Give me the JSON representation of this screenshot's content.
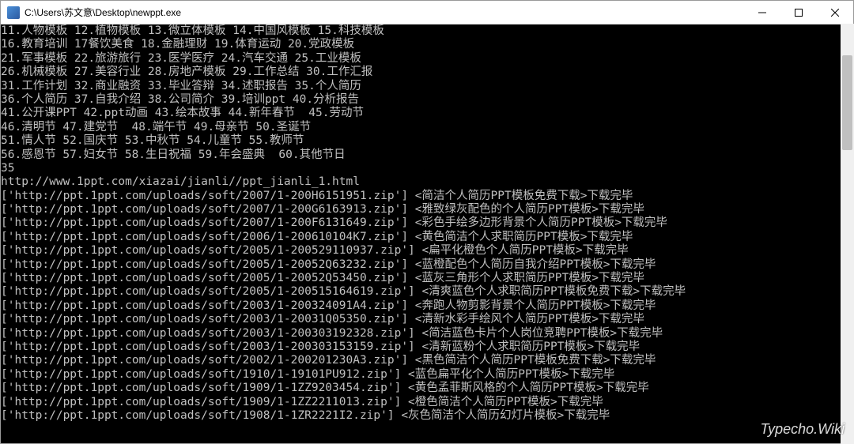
{
  "window": {
    "title": "C:\\Users\\苏文意\\Desktop\\newppt.exe"
  },
  "watermark": "Typecho.Wiki",
  "categories": [
    "11.人物模板 12.植物模板 13.微立体模板 14.中国风模板 15.科技模板",
    "16.教育培训 17餐饮美食 18.金融理财 19.体育运动 20.党政模板",
    "21.军事模板 22.旅游旅行 23.医学医疗 24.汽车交通 25.工业模板",
    "26.机械模板 27.美容行业 28.房地产模板 29.工作总结 30.工作汇报",
    "31.工作计划 32.商业融资 33.毕业答辩 34.述职报告 35.个人简历",
    "36.个人简历 37.自我介绍 38.公司简介 39.培训ppt 40.分析报告",
    "41.公开课PPT 42.ppt动画 43.绘本故事 44.新年春节  45.劳动节",
    "46.清明节 47.建党节  48.端午节 49.母亲节 50.圣诞节",
    "51.情人节 52.国庆节 53.中秋节 54.儿童节 55.教师节",
    "56.感恩节 57.妇女节 58.生日祝福 59.年会盛典  60.其他节日"
  ],
  "selection": "35",
  "url": "http://www.1ppt.com/xiazai/jianli//ppt_jianli_1.html",
  "downloads": [
    {
      "file": "['http://ppt.1ppt.com/uploads/soft/2007/1-200H6151951.zip'] ",
      "desc": "<简洁个人简历PPT模板免费下载>下载完毕"
    },
    {
      "file": "['http://ppt.1ppt.com/uploads/soft/2007/1-200G6163913.zip'] ",
      "desc": "<雅致绿灰配色的个人简历PPT模板>下载完毕"
    },
    {
      "file": "['http://ppt.1ppt.com/uploads/soft/2007/1-200F6131649.zip'] ",
      "desc": "<彩色手绘多边形背景个人简历PPT模板>下载完毕"
    },
    {
      "file": "['http://ppt.1ppt.com/uploads/soft/2006/1-200610104K7.zip'] ",
      "desc": "<黄色简洁个人求职简历PPT模板>下载完毕"
    },
    {
      "file": "['http://ppt.1ppt.com/uploads/soft/2005/1-200529110937.zip'] ",
      "desc": "<扁平化橙色个人简历PPT模板>下载完毕"
    },
    {
      "file": "['http://ppt.1ppt.com/uploads/soft/2005/1-20052Q63232.zip'] ",
      "desc": "<蓝橙配色个人简历自我介绍PPT模板>下载完毕"
    },
    {
      "file": "['http://ppt.1ppt.com/uploads/soft/2005/1-20052Q53450.zip'] ",
      "desc": "<蓝灰三角形个人求职简历PPT模板>下载完毕"
    },
    {
      "file": "['http://ppt.1ppt.com/uploads/soft/2005/1-200515164619.zip'] ",
      "desc": "<清爽蓝色个人求职简历PPT模板免费下载>下载完毕"
    },
    {
      "file": "['http://ppt.1ppt.com/uploads/soft/2003/1-200324091A4.zip'] ",
      "desc": "<奔跑人物剪影背景个人简历PPT模板>下载完毕"
    },
    {
      "file": "['http://ppt.1ppt.com/uploads/soft/2003/1-20031Q05350.zip'] ",
      "desc": "<清新水彩手绘风个人简历PPT模板>下载完毕"
    },
    {
      "file": "['http://ppt.1ppt.com/uploads/soft/2003/1-200303192328.zip'] ",
      "desc": "<简洁蓝色卡片个人岗位竞聘PPT模板>下载完毕"
    },
    {
      "file": "['http://ppt.1ppt.com/uploads/soft/2003/1-200303153159.zip'] ",
      "desc": "<清新蓝粉个人求职简历PPT模板>下载完毕"
    },
    {
      "file": "['http://ppt.1ppt.com/uploads/soft/2002/1-200201230A3.zip'] ",
      "desc": "<黑色简洁个人简历PPT模板免费下载>下载完毕"
    },
    {
      "file": "['http://ppt.1ppt.com/uploads/soft/1910/1-19101PU912.zip'] ",
      "desc": "<蓝色扁平化个人简历PPT模板>下载完毕"
    },
    {
      "file": "['http://ppt.1ppt.com/uploads/soft/1909/1-1ZZ9203454.zip'] ",
      "desc": "<黄色孟菲斯风格的个人简历PPT模板>下载完毕"
    },
    {
      "file": "['http://ppt.1ppt.com/uploads/soft/1909/1-1ZZ2211013.zip'] ",
      "desc": "<橙色简洁个人简历PPT模板>下载完毕"
    },
    {
      "file": "['http://ppt.1ppt.com/uploads/soft/1908/1-1ZR2221I2.zip'] ",
      "desc": "<灰色简洁个人简历幻灯片模板>下载完毕"
    }
  ]
}
